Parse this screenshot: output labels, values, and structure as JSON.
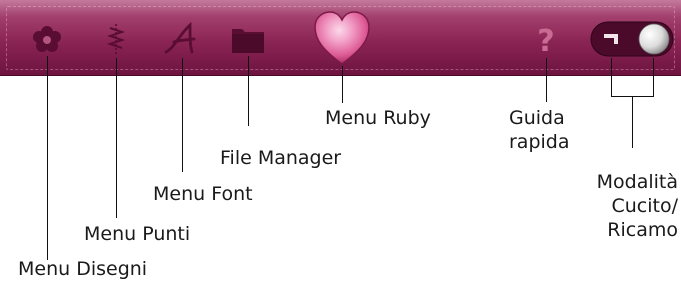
{
  "toolbar": {
    "colors": {
      "bar": "#8a2454",
      "icon": "#5a0d33",
      "heart": "#e56aa2",
      "help": "#c96b93"
    },
    "buttons": [
      {
        "id": "menu-disegni",
        "icon": "flower-icon",
        "label": "Menu Disegni"
      },
      {
        "id": "menu-punti",
        "icon": "stitch-icon",
        "label": "Menu Punti"
      },
      {
        "id": "menu-font",
        "icon": "font-icon",
        "label": "Menu Font"
      },
      {
        "id": "file-manager",
        "icon": "folder-icon",
        "label": "File Manager"
      },
      {
        "id": "menu-ruby",
        "icon": "heart-icon",
        "label": "Menu Ruby"
      },
      {
        "id": "guida-rapida",
        "icon": "question-mark-icon",
        "label_lines": [
          "Guida",
          "rapida"
        ]
      },
      {
        "id": "modalita",
        "icon": "mode-toggle-icon",
        "label_lines": [
          "Modalità",
          "Cucito/",
          "Ricamo"
        ]
      }
    ]
  }
}
